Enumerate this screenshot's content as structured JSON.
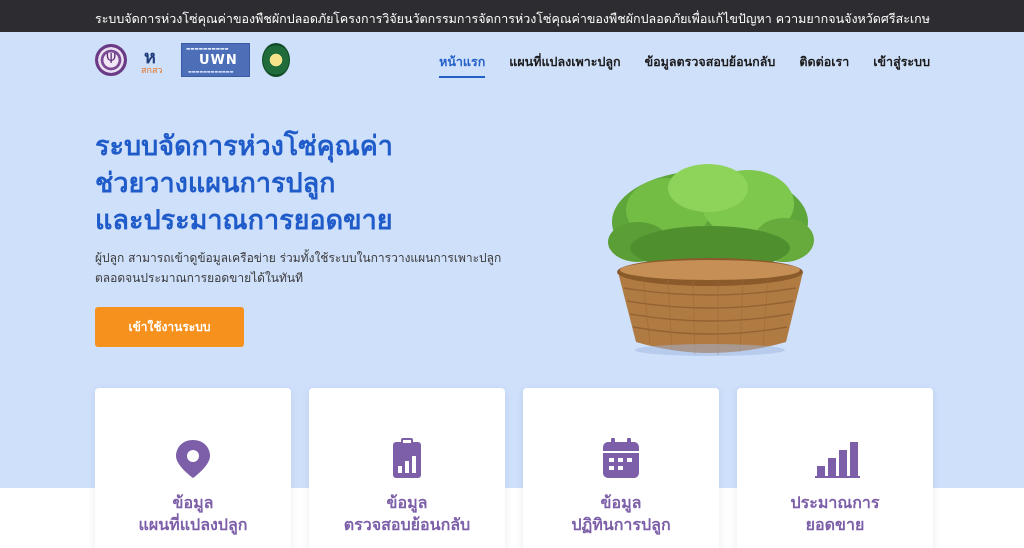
{
  "topbar": {
    "left": "ระบบจัดการห่วงโซ่คุณค่าของพืชผักปลอดภัย",
    "right": "โครงการวิจัยนวัตกรรมการจัดการห่วงโซ่คุณค่าของพืชผักปลอดภัยเพื่อแก้ไขปัญหา ความยากจนจังหวัดศรีสะเกษ"
  },
  "logos": {
    "logo2_text": "สกสว",
    "logo3_text": "UWN"
  },
  "nav": {
    "items": [
      {
        "label": "หน้าแรก",
        "active": true
      },
      {
        "label": "แผนที่แปลงเพาะปลูก",
        "active": false
      },
      {
        "label": "ข้อมูลตรวจสอบย้อนกลับ",
        "active": false
      },
      {
        "label": "ติดต่อเรา",
        "active": false
      },
      {
        "label": "เข้าสู่ระบบ",
        "active": false
      }
    ]
  },
  "hero": {
    "title_lines": [
      "ระบบจัดการห่วงโซ่คุณค่า",
      "ช่วยวางแผนการปลูก",
      "และประมาณการยอดขาย"
    ],
    "desc_lines": [
      "ผู้ปลูก สามารถเข้าดูข้อมูลเครือข่าย ร่วมทั้งใช้ระบบในการวางแผนการเพาะปลูก",
      "ตลอดจนประมาณการยอดขายได้ในทันที"
    ],
    "cta_label": "เข้าใช้งานระบบ"
  },
  "colors": {
    "accent": "#1f5bc9",
    "cta": "#f6911e",
    "card_text": "#7c5fa8",
    "hero_bg": "#cfe0fb",
    "topbar_bg": "#2d2d31"
  },
  "cards": [
    {
      "icon": "map-pin-icon",
      "lines": [
        "ข้อมูล",
        "แผนที่แปลงปลูก"
      ]
    },
    {
      "icon": "clipboard-chart-icon",
      "lines": [
        "ข้อมูล",
        "ตรวจสอบย้อนกลับ"
      ]
    },
    {
      "icon": "calendar-icon",
      "lines": [
        "ข้อมูล",
        "ปฏิทินการปลูก"
      ]
    },
    {
      "icon": "bar-chart-icon",
      "lines": [
        "ประมาณการ",
        "ยอดขาย"
      ]
    }
  ]
}
